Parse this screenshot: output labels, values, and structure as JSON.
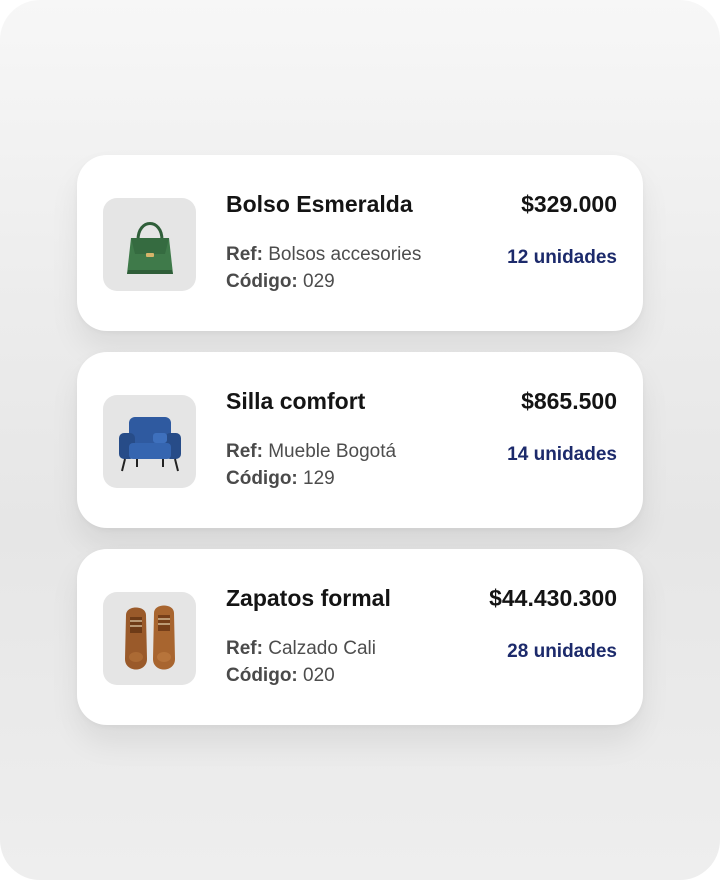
{
  "products": [
    {
      "name": "Bolso Esmeralda",
      "ref_label": "Ref:",
      "ref_value": "Bolsos accesories",
      "code_label": "Código:",
      "code_value": "029",
      "price": "$329.000",
      "units": "12 unidades",
      "icon": "handbag-icon"
    },
    {
      "name": "Silla comfort",
      "ref_label": "Ref:",
      "ref_value": "Mueble Bogotá",
      "code_label": "Código:",
      "code_value": "129",
      "price": "$865.500",
      "units": "14 unidades",
      "icon": "armchair-icon"
    },
    {
      "name": "Zapatos formal",
      "ref_label": "Ref:",
      "ref_value": "Calzado Cali",
      "code_label": "Código:",
      "code_value": "020",
      "price": "$44.430.300",
      "units": "28 unidades",
      "icon": "shoes-icon"
    }
  ],
  "colors": {
    "units_text": "#1c2a6b",
    "handbag": "#3f7a4a",
    "armchair": "#2f5aa0",
    "shoes": "#9a5a2a"
  }
}
